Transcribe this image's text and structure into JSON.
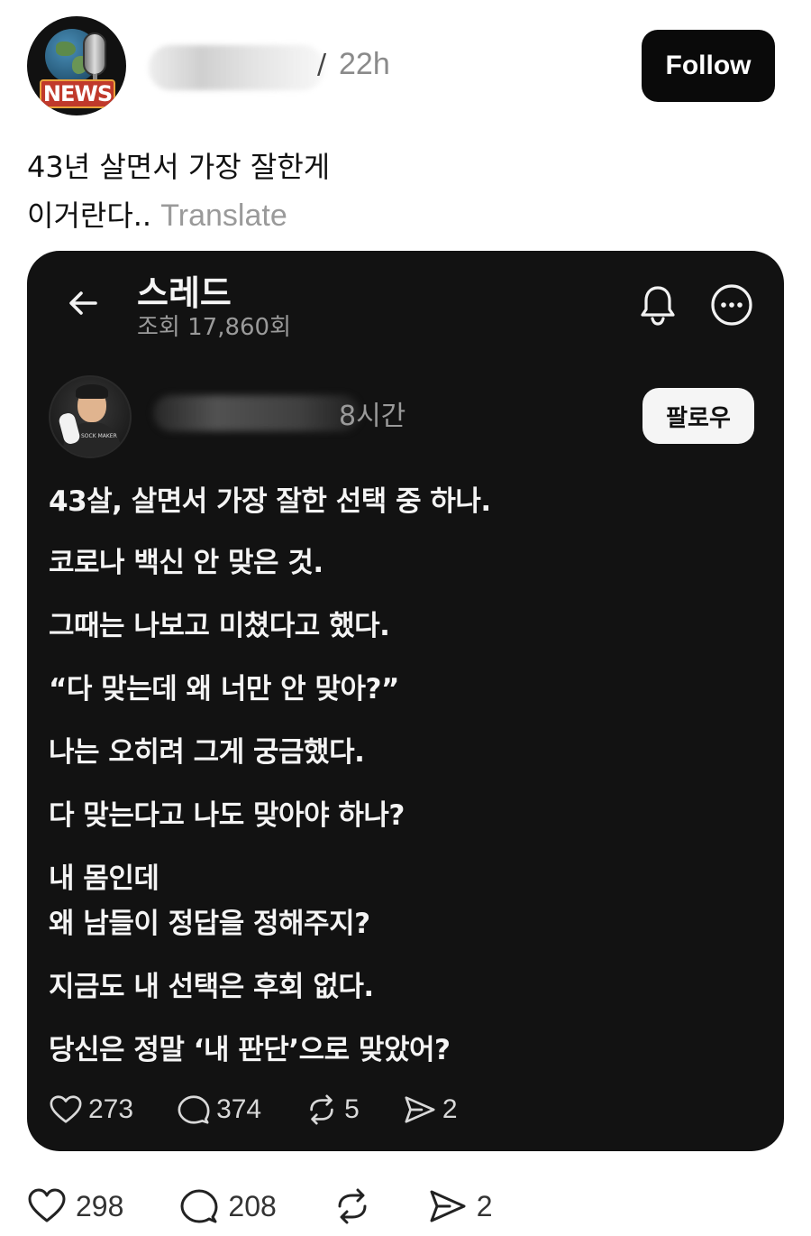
{
  "post": {
    "channel_badge_text": "NEWS",
    "time": "22h",
    "follow_label": "Follow",
    "caption_line1": "43년 살면서 가장 잘한게",
    "caption_line2": "이거란다..",
    "translate_label": "Translate"
  },
  "embedded": {
    "header_title": "스레드",
    "views": "조회 17,860회",
    "author_time": "8시간",
    "follow_label": "팔로우",
    "avatar_shirt_text": "SOCK MAKER",
    "lines": [
      "43살, 살면서 가장 잘한 선택 중 하나.",
      "코로나 백신 안 맞은 것.",
      "그때는 나보고 미쳤다고 했다.",
      "“다 맞는데 왜 너만 안 맞아?”",
      "나는 오히려 그게 궁금했다.",
      "다 맞는다고 나도 맞아야 하나?",
      "내 몸인데",
      "왜 남들이 정답을 정해주지?",
      "지금도 내 선택은 후회 없다.",
      "당신은 정말 ‘내 판단’으로 맞았어?"
    ],
    "likes": "273",
    "comments": "374",
    "reposts": "5",
    "shares": "2"
  },
  "actions": {
    "likes": "298",
    "comments": "208",
    "shares": "2"
  },
  "icons": {
    "avatar": "news-globe-microphone-logo",
    "back": "arrow-left-icon",
    "bell": "bell-icon",
    "more": "more-circle-icon",
    "like": "heart-icon",
    "comment": "comment-bubble-icon",
    "repost": "repost-icon",
    "share": "send-icon"
  },
  "colors": {
    "card_bg": "#121212",
    "follow_bg": "#0a0a0a",
    "muted": "#9a9a9a",
    "badge_red": "#c0392b"
  }
}
